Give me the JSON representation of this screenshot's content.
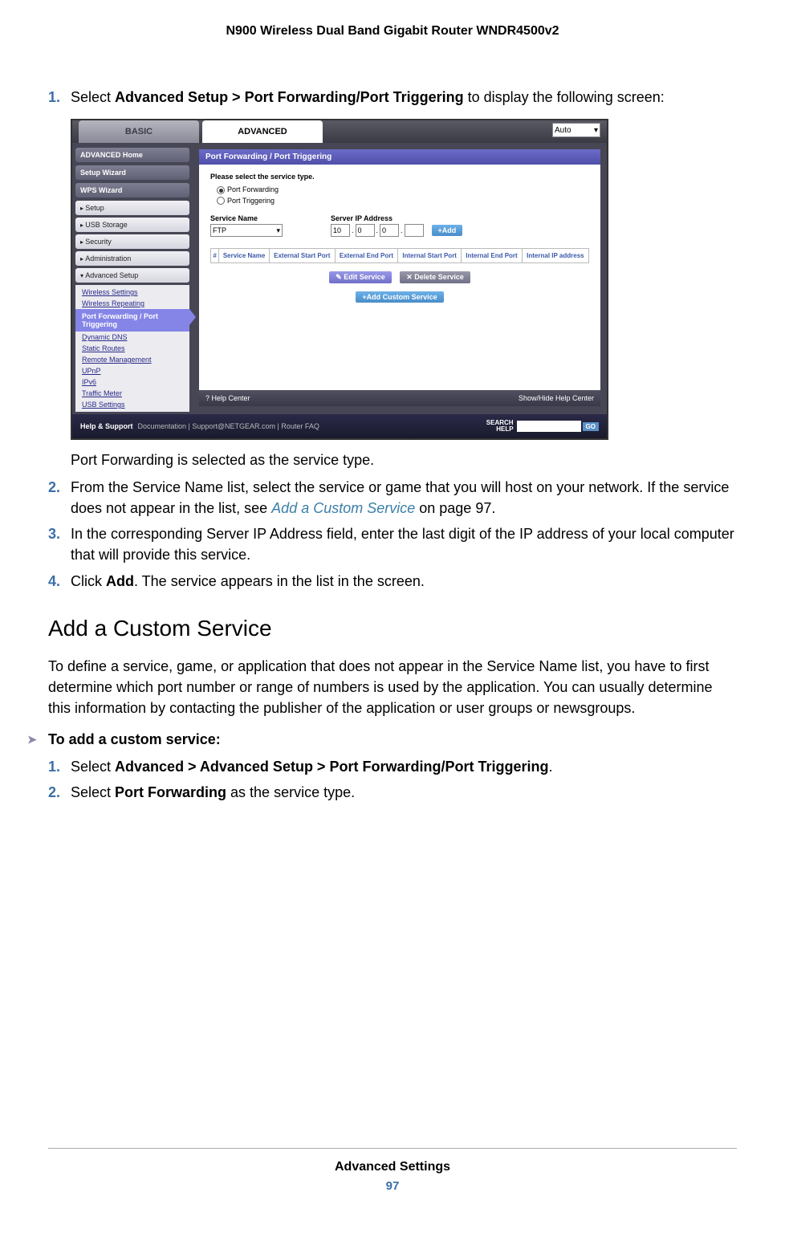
{
  "header": {
    "title": "N900 Wireless Dual Band Gigabit Router WNDR4500v2"
  },
  "steps1": {
    "s1": {
      "num": "1.",
      "pre": "Select ",
      "bold": "Advanced Setup > Port Forwarding/Port Triggering",
      "post": " to display the following screen:"
    },
    "after_img": "Port Forwarding is selected as the service type.",
    "s2": {
      "num": "2.",
      "pre": "From the Service Name list, select the service or game that you will host on your network. If the service does not appear in the list, see ",
      "link": "Add a Custom Service",
      "post": " on page 97."
    },
    "s3": {
      "num": "3.",
      "text": "In the corresponding Server IP Address field, enter the last digit of the IP address of your local computer that will provide this service."
    },
    "s4": {
      "num": "4.",
      "pre": "Click ",
      "bold": "Add",
      "post": ". The service appears in the list in the screen."
    }
  },
  "section": {
    "title": "Add a Custom Service",
    "intro": "To define a service, game, or application that does not appear in the Service Name list, you have to first determine which port number or range of numbers is used by the application. You can usually determine this information by contacting the publisher of the application or user groups or newsgroups.",
    "task": "To add a custom service:",
    "s1": {
      "num": "1.",
      "pre": "Select ",
      "bold": "Advanced > Advanced Setup > Port Forwarding/Port Triggering",
      "post": "."
    },
    "s2": {
      "num": "2.",
      "pre": "Select ",
      "bold": "Port Forwarding",
      "post": " as the service type."
    }
  },
  "router": {
    "tabs": {
      "basic": "BASIC",
      "advanced": "ADVANCED",
      "auto": "Auto"
    },
    "sidebar": {
      "home": "ADVANCED Home",
      "wizard": "Setup Wizard",
      "wps": "WPS Wizard",
      "setup": "Setup",
      "usb": "USB Storage",
      "security": "Security",
      "admin": "Administration",
      "adv": "Advanced Setup",
      "subs": {
        "ws": "Wireless Settings",
        "wr": "Wireless Repeating",
        "pf": "Port Forwarding / Port Triggering",
        "dns": "Dynamic DNS",
        "sr": "Static Routes",
        "rm": "Remote Management",
        "upnp": "UPnP",
        "ipv6": "IPv6",
        "tm": "Traffic Meter",
        "usbs": "USB Settings"
      }
    },
    "panel": {
      "title": "Port Forwarding / Port Triggering",
      "prompt": "Please select the service type.",
      "r1": "Port Forwarding",
      "r2": "Port Triggering",
      "sn": "Service Name",
      "sip": "Server IP Address",
      "sn_val": "FTP",
      "ip": {
        "a": "10",
        "b": "0",
        "c": "0",
        "d": ""
      },
      "add": "+Add",
      "th": {
        "n": "#",
        "sn": "Service Name",
        "esp": "External Start Port",
        "eep": "External End Port",
        "isp": "Internal Start Port",
        "iep": "Internal End Port",
        "iip": "Internal IP address"
      },
      "edit": "✎ Edit Service",
      "del": "✕ Delete Service",
      "custom": "+Add Custom Service",
      "help": "? Help Center",
      "showhide": "Show/Hide Help Center"
    },
    "footer": {
      "hs": "Help & Support",
      "links": "Documentation | Support@NETGEAR.com | Router FAQ",
      "srch": "SEARCH HELP",
      "go": "GO"
    }
  },
  "pagefoot": {
    "section": "Advanced Settings",
    "page": "97"
  }
}
